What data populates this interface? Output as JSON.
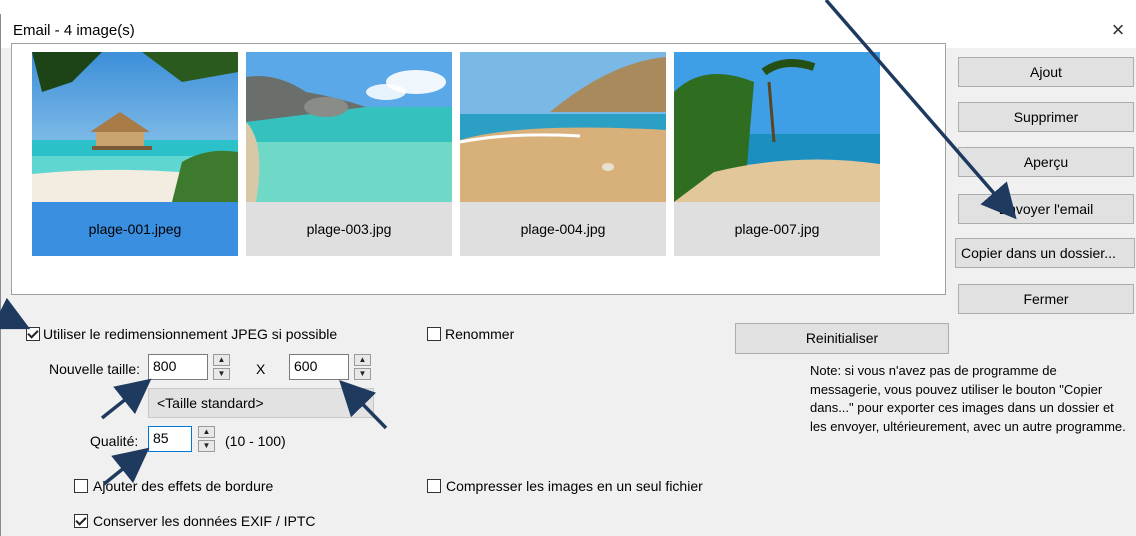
{
  "window": {
    "title": "Email  -  4 image(s)",
    "close_glyph": "×"
  },
  "thumbnails": [
    {
      "filename": "plage-001.jpeg",
      "selected": true
    },
    {
      "filename": "plage-003.jpg",
      "selected": false
    },
    {
      "filename": "plage-004.jpg",
      "selected": false
    },
    {
      "filename": "plage-007.jpg",
      "selected": false
    }
  ],
  "buttons": {
    "ajout": "Ajout",
    "supprimer": "Supprimer",
    "apercu": "Aperçu",
    "envoyer": "Envoyer l'email",
    "copier": "Copier dans un dossier...",
    "fermer": "Fermer",
    "reinitialiser": "Reinitialiser"
  },
  "options": {
    "resize_label": "Utiliser le redimensionnement JPEG si possible",
    "resize_checked": true,
    "rename_label": "Renommer",
    "rename_checked": false,
    "new_size_label": "Nouvelle taille:",
    "width": "800",
    "times": "X",
    "height": "600",
    "standard_size": "<Taille standard>",
    "quality_label": "Qualité:",
    "quality": "85",
    "quality_range": "(10 - 100)",
    "border_label": "Ajouter des effets de bordure",
    "border_checked": false,
    "compress_label": "Compresser les images en un seul fichier",
    "compress_checked": false,
    "exif_label": "Conserver les données EXIF / IPTC",
    "exif_checked": true
  },
  "note": "Note: si vous n'avez pas de programme de messagerie, vous pouvez utiliser le bouton \"Copier dans...\" pour exporter ces images dans un dossier et les envoyer, ultérieurement, avec un autre programme.",
  "colors": {
    "selection": "#3a8fe0",
    "annotation_arrow": "#1f3a5f"
  }
}
